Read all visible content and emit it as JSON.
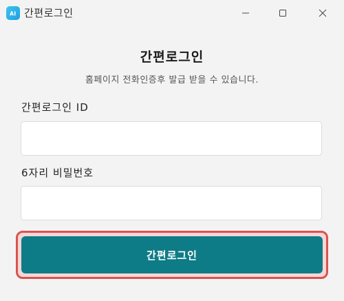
{
  "window": {
    "title": "간편로그인",
    "app_icon_text": "AI",
    "controls": [
      "minimize-icon",
      "maximize-icon",
      "close-icon"
    ]
  },
  "main": {
    "heading": "간편로그인",
    "subtitle": "홈페이지 전화인증후 발급 받을 수 있습니다.",
    "id_label": "간편로그인 ID",
    "id_value": "",
    "pin_label": "6자리 비밀번호",
    "pin_value": "",
    "login_button": "간편로그인"
  },
  "colors": {
    "background": "#f3f3f3",
    "accent": "#0e7c86",
    "highlight_border": "#d9534f",
    "app_icon": "#1f9fe0"
  }
}
